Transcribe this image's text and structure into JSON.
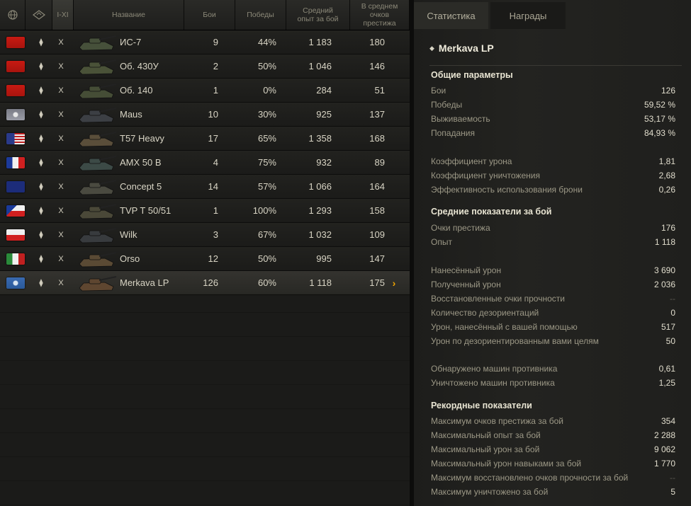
{
  "table": {
    "headers": {
      "level": "I-XI",
      "name": "Название",
      "battles": "Бои",
      "wins": "Победы",
      "avg_xp": "Средний опыт за бой",
      "avg_prestige": "В среднем очков престижа"
    },
    "rows": [
      {
        "flag": "ussr",
        "name": "ИС-7",
        "level": "X",
        "battles": "9",
        "wins": "44%",
        "xp": "1 183",
        "prestige": "180",
        "camo": "#46503a"
      },
      {
        "flag": "ussr",
        "name": "Об. 430У",
        "level": "X",
        "battles": "2",
        "wins": "50%",
        "xp": "1 046",
        "prestige": "146",
        "camo": "#4a5238"
      },
      {
        "flag": "ussr",
        "name": "Об. 140",
        "level": "X",
        "battles": "1",
        "wins": "0%",
        "xp": "284",
        "prestige": "51",
        "camo": "#454d36"
      },
      {
        "flag": "germany",
        "name": "Maus",
        "level": "X",
        "battles": "10",
        "wins": "30%",
        "xp": "925",
        "prestige": "137",
        "camo": "#3c3f44"
      },
      {
        "flag": "usa",
        "name": "T57 Heavy",
        "level": "X",
        "battles": "17",
        "wins": "65%",
        "xp": "1 358",
        "prestige": "168",
        "camo": "#5a4e3a"
      },
      {
        "flag": "france",
        "name": "AMX 50 B",
        "level": "X",
        "battles": "4",
        "wins": "75%",
        "xp": "932",
        "prestige": "89",
        "camo": "#3c4a46"
      },
      {
        "flag": "uk",
        "name": "Concept 5",
        "level": "X",
        "battles": "14",
        "wins": "57%",
        "xp": "1 066",
        "prestige": "164",
        "camo": "#4a4a40"
      },
      {
        "flag": "czech",
        "name": "TVP T 50/51",
        "level": "X",
        "battles": "1",
        "wins": "100%",
        "xp": "1 293",
        "prestige": "158",
        "camo": "#4a4838"
      },
      {
        "flag": "poland",
        "name": "Wilk",
        "level": "X",
        "battles": "3",
        "wins": "67%",
        "xp": "1 032",
        "prestige": "109",
        "camo": "#383b3e"
      },
      {
        "flag": "italy",
        "name": "Orso",
        "level": "X",
        "battles": "12",
        "wins": "50%",
        "xp": "995",
        "prestige": "147",
        "camo": "#5a4a34"
      },
      {
        "flag": "intunion",
        "name": "Merkava LP",
        "level": "X",
        "battles": "126",
        "wins": "60%",
        "xp": "1 118",
        "prestige": "175",
        "camo": "#5e4630",
        "active": true
      }
    ]
  },
  "tabs": {
    "stats": "Статистика",
    "awards": "Награды"
  },
  "panel": {
    "title": "Merkava LP",
    "general": {
      "heading": "Общие параметры",
      "items": [
        {
          "label": "Бои",
          "value": "126"
        },
        {
          "label": "Победы",
          "value": "59,52 %"
        },
        {
          "label": "Выживаемость",
          "value": "53,17 %"
        },
        {
          "label": "Попадания",
          "value": "84,93 %"
        }
      ],
      "ratios": [
        {
          "label": "Коэффициент урона",
          "value": "1,81"
        },
        {
          "label": "Коэффициент уничтожения",
          "value": "2,68"
        },
        {
          "label": "Эффективность использования брони",
          "value": "0,26"
        }
      ]
    },
    "average": {
      "heading": "Средние показатели за бой",
      "items": [
        {
          "label": "Очки престижа",
          "value": "176"
        },
        {
          "label": "Опыт",
          "value": "1 118"
        }
      ],
      "damage": [
        {
          "label": "Нанесённый урон",
          "value": "3 690"
        },
        {
          "label": "Полученный урон",
          "value": "2 036"
        },
        {
          "label": "Восстановленные очки прочности",
          "value": "--"
        },
        {
          "label": "Количество дезориентаций",
          "value": "0"
        },
        {
          "label": "Урон, нанесённый с вашей помощью",
          "value": "517"
        },
        {
          "label": "Урон по дезориентированным вами целям",
          "value": "50"
        }
      ],
      "kills": [
        {
          "label": "Обнаружено машин противника",
          "value": "0,61"
        },
        {
          "label": "Уничтожено машин противника",
          "value": "1,25"
        }
      ]
    },
    "records": {
      "heading": "Рекордные показатели",
      "items": [
        {
          "label": "Максимум очков престижа за бой",
          "value": "354"
        },
        {
          "label": "Максимальный опыт за бой",
          "value": "2 288"
        },
        {
          "label": "Максимальный урон за бой",
          "value": "9 062"
        },
        {
          "label": "Максимальный урон навыками за бой",
          "value": "1 770"
        },
        {
          "label": "Максимум восстановлено очков прочности за бой",
          "value": "--"
        },
        {
          "label": "Максимум уничтожено за бой",
          "value": "5"
        }
      ]
    }
  }
}
